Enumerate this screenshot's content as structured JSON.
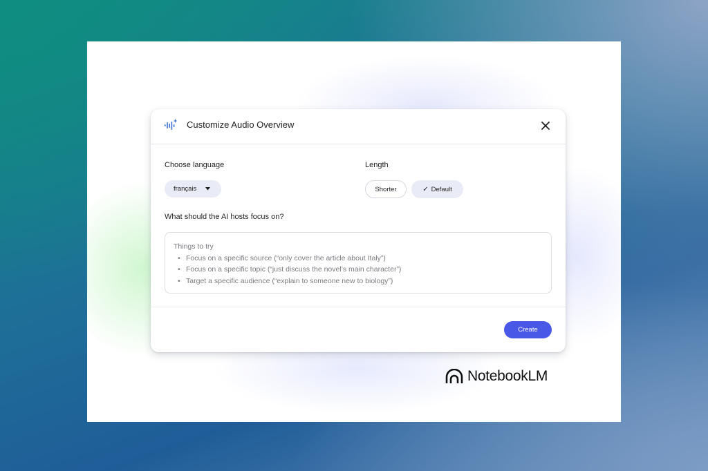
{
  "dialog": {
    "title": "Customize Audio Overview",
    "close_icon": "close-icon",
    "audio_icon": "audio-sparkle-icon"
  },
  "language": {
    "label": "Choose language",
    "selected": "français"
  },
  "length": {
    "label": "Length",
    "options": [
      {
        "label": "Shorter",
        "selected": false
      },
      {
        "label": "Default",
        "selected": true
      }
    ]
  },
  "focus": {
    "label": "What should the AI hosts focus on?",
    "placeholder_heading": "Things to try",
    "suggestions": [
      "Focus on a specific source (“only cover the article about Italy”)",
      "Focus on a specific topic (“just discuss the novel’s main character”)",
      "Target a specific audience (“explain to someone new to biology”)"
    ]
  },
  "actions": {
    "create_label": "Create"
  },
  "brand": {
    "name": "NotebookLM"
  },
  "colors": {
    "primary": "#4a58e8",
    "chip_bg": "#e9ebf6",
    "icon_blue": "#3b6fd9"
  }
}
